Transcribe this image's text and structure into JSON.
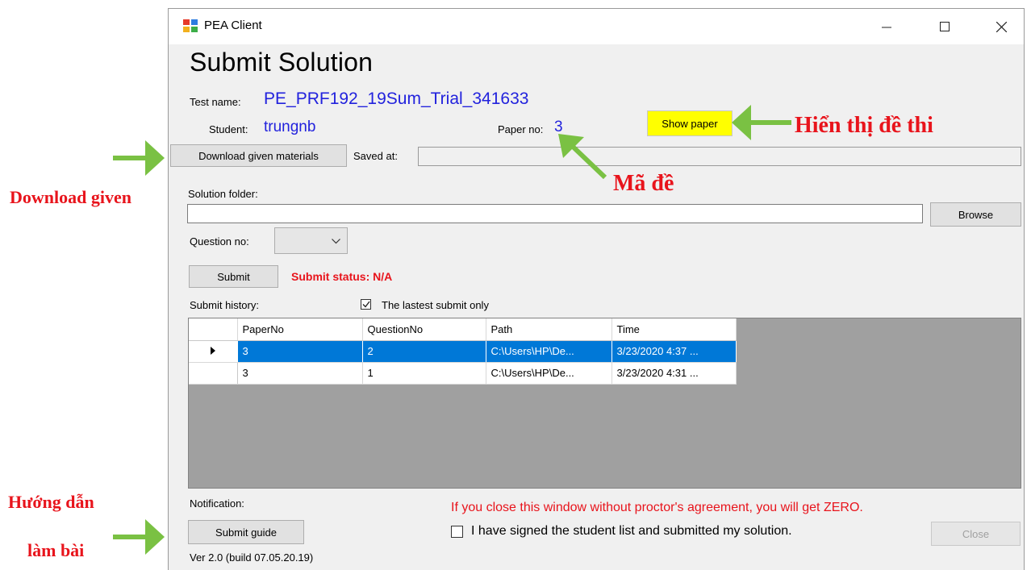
{
  "window": {
    "title": "PEA Client",
    "heading": "Submit Solution",
    "test_name_label": "Test name:",
    "test_name_value": "PE_PRF192_19Sum_Trial_341633",
    "student_label": "Student:",
    "student_value": "trungnb",
    "paper_no_label": "Paper no:",
    "paper_no_value": "3",
    "show_paper_label": "Show paper",
    "download_label": "Download given materials",
    "saved_at_label": "Saved at:",
    "saved_at_value": "",
    "solution_folder_label": "Solution folder:",
    "solution_folder_value": "",
    "browse_label": "Browse",
    "question_no_label": "Question no:",
    "question_no_value": "",
    "submit_label": "Submit",
    "submit_status": "Submit status: N/A",
    "submit_history_label": "Submit history:",
    "latest_only_label": "The lastest submit only",
    "latest_only_checked": true,
    "notification_label": "Notification:",
    "warning": "If you close this window without proctor's agreement, you will get ZERO.",
    "submit_guide_label": "Submit guide",
    "signed_label": "I have signed the student list and submitted my solution.",
    "close_label": "Close",
    "version": "Ver 2.0 (build 07.05.20.19)"
  },
  "history": {
    "columns": [
      "PaperNo",
      "QuestionNo",
      "Path",
      "Time"
    ],
    "rows": [
      {
        "paper": "3",
        "question": "2",
        "path": "C:\\Users\\HP\\De...",
        "time": "3/23/2020 4:37 ...",
        "selected": true
      },
      {
        "paper": "3",
        "question": "1",
        "path": "C:\\Users\\HP\\De...",
        "time": "3/23/2020 4:31 ...",
        "selected": false
      }
    ]
  },
  "annotations": {
    "show_paper": "Hiển thị đề thi",
    "paper_code": "Mã đề",
    "download": "Download given",
    "guide_line1": "Hướng dẫn",
    "guide_line2": "làm bài"
  },
  "colors": {
    "accent_blue": "#2222dd",
    "warning_red": "#e8141c",
    "arrow_green": "#7ac143",
    "show_paper_yellow": "#ffff00",
    "selection_blue": "#0078d7"
  }
}
